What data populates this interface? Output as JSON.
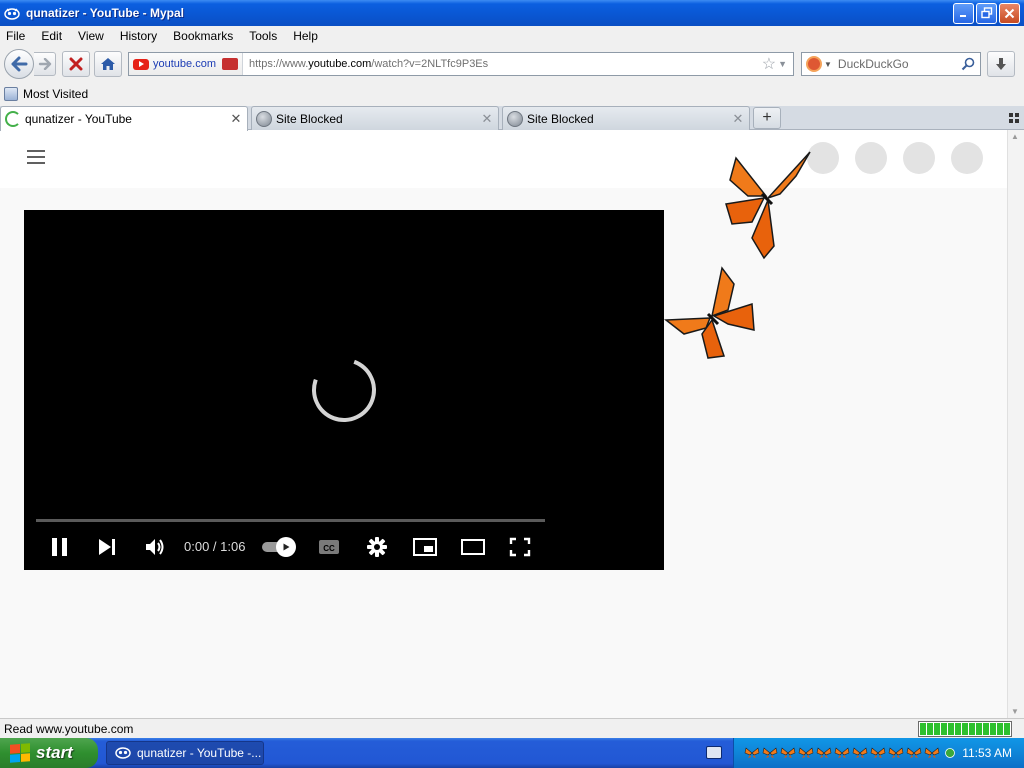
{
  "window": {
    "title": "qunatizer - YouTube - Mypal"
  },
  "menu": [
    "File",
    "Edit",
    "View",
    "History",
    "Bookmarks",
    "Tools",
    "Help"
  ],
  "navbar": {
    "site_domain": "youtube.com",
    "url_prefix": "https://www.",
    "url_host": "youtube.com",
    "url_path": "/watch?v=2NLTfc9P3Es",
    "search_placeholder": "DuckDuckGo"
  },
  "bookmarks": {
    "most_visited": "Most Visited"
  },
  "tabs": [
    {
      "label": "qunatizer - YouTube",
      "icon": "loading-spinner-icon",
      "active": true
    },
    {
      "label": "Site Blocked",
      "icon": "globe-icon",
      "active": false
    },
    {
      "label": "Site Blocked",
      "icon": "globe-icon",
      "active": false
    }
  ],
  "player": {
    "time": "0:00 / 1:06",
    "progress": 0,
    "autoplay": true,
    "state": "loading"
  },
  "status": {
    "text": "Read www.youtube.com",
    "progress": 1.0
  },
  "taskbar": {
    "start_label": "start",
    "task_label": "qunatizer - YouTube -...",
    "clock": "11:53 AM"
  },
  "colors": {
    "accent": "#0a56d2",
    "player_bg": "#000000",
    "youtube_red": "#e62117",
    "butterfly": "#f07a1a"
  }
}
